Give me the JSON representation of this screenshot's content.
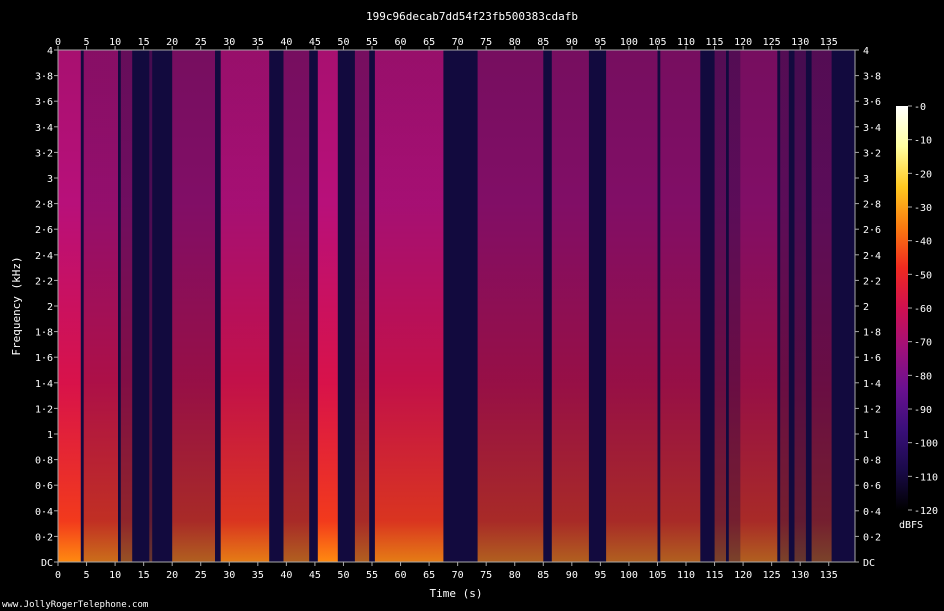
{
  "title": "199c96decab7dd54f23fb500383cdafb",
  "credit": "www.JollyRogerTelephone.com",
  "chart_data": {
    "type": "heatmap",
    "title": "199c96decab7dd54f23fb500383cdafb",
    "xlabel": "Time (s)",
    "ylabel": "Frequency (kHz)",
    "xlim": [
      0,
      139.6
    ],
    "ylim": [
      0,
      4
    ],
    "x_ticks": [
      "0",
      "5",
      "10",
      "15",
      "20",
      "25",
      "30",
      "35",
      "40",
      "45",
      "50",
      "55",
      "60",
      "65",
      "70",
      "75",
      "80",
      "85",
      "90",
      "95",
      "100",
      "105",
      "110",
      "115",
      "120",
      "125",
      "130",
      "135"
    ],
    "y_ticks": [
      "DC",
      "0·2",
      "0·4",
      "0·6",
      "0·8",
      "1",
      "1·2",
      "1·4",
      "1·6",
      "1·8",
      "2",
      "2·2",
      "2·4",
      "2·6",
      "2·8",
      "3",
      "3·2",
      "3·4",
      "3·6",
      "3·8",
      "4"
    ],
    "colorbar": {
      "label": "dBFS",
      "ticks": [
        "-0",
        "-10",
        "-20",
        "-30",
        "-40",
        "-50",
        "-60",
        "-70",
        "-80",
        "-90",
        "-100",
        "-110",
        "-120"
      ],
      "range": [
        -120,
        0
      ],
      "colors": [
        "#000000",
        "#1a0a4a",
        "#3a0f7a",
        "#6a1090",
        "#a0107a",
        "#d01050",
        "#f02a20",
        "#fa7a10",
        "#ffc820",
        "#ffffa0",
        "#ffffff"
      ]
    },
    "segments_s": [
      {
        "start": 0.0,
        "end": 4.0,
        "level": -30
      },
      {
        "start": 4.5,
        "end": 10.5,
        "level": -40
      },
      {
        "start": 11.0,
        "end": 13.0,
        "level": -50
      },
      {
        "start": 16.0,
        "end": 16.5,
        "level": -60
      },
      {
        "start": 20.0,
        "end": 27.5,
        "level": -45
      },
      {
        "start": 28.5,
        "end": 37.0,
        "level": -35
      },
      {
        "start": 39.5,
        "end": 44.0,
        "level": -45
      },
      {
        "start": 45.5,
        "end": 49.0,
        "level": -30
      },
      {
        "start": 52.0,
        "end": 54.5,
        "level": -45
      },
      {
        "start": 55.5,
        "end": 67.5,
        "level": -35
      },
      {
        "start": 73.5,
        "end": 85.0,
        "level": -45
      },
      {
        "start": 86.5,
        "end": 93.0,
        "level": -45
      },
      {
        "start": 96.0,
        "end": 105.0,
        "level": -45
      },
      {
        "start": 105.5,
        "end": 112.5,
        "level": -45
      },
      {
        "start": 115.0,
        "end": 117.0,
        "level": -55
      },
      {
        "start": 117.5,
        "end": 119.5,
        "level": -55
      },
      {
        "start": 119.5,
        "end": 126.0,
        "level": -45
      },
      {
        "start": 126.5,
        "end": 128.0,
        "level": -55
      },
      {
        "start": 129.0,
        "end": 131.0,
        "level": -60
      },
      {
        "start": 132.0,
        "end": 135.5,
        "level": -55
      }
    ]
  }
}
